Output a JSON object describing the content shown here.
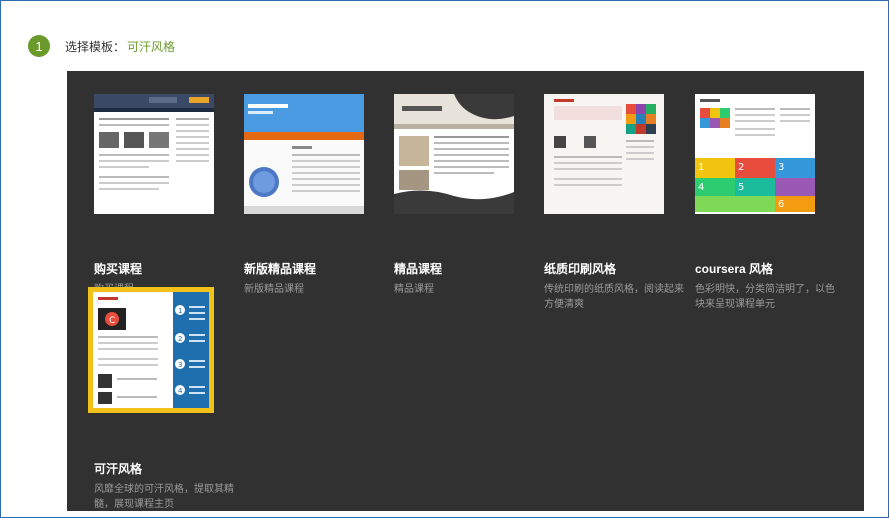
{
  "step": {
    "number": "1",
    "label": "选择模板：",
    "selected_value": "可汗风格"
  },
  "templates": [
    {
      "title": "购买课程",
      "desc": "购买课程"
    },
    {
      "title": "新版精品课程",
      "desc": "新版精品课程"
    },
    {
      "title": "精品课程",
      "desc": "精品课程"
    },
    {
      "title": "纸质印刷风格",
      "desc": "传统印刷的纸质风格，阅读起来方便清爽"
    },
    {
      "title": "coursera 风格",
      "desc": "色彩明快，分类简洁明了，以色块来呈现课程单元"
    },
    {
      "title": "可汗风格",
      "desc": "风靡全球的可汗风格，提取其精髓，展现课程主页"
    }
  ],
  "colors": {
    "accent_green": "#6a9a2c",
    "gallery_bg": "#313131",
    "selected_border": "#f2c21b"
  }
}
